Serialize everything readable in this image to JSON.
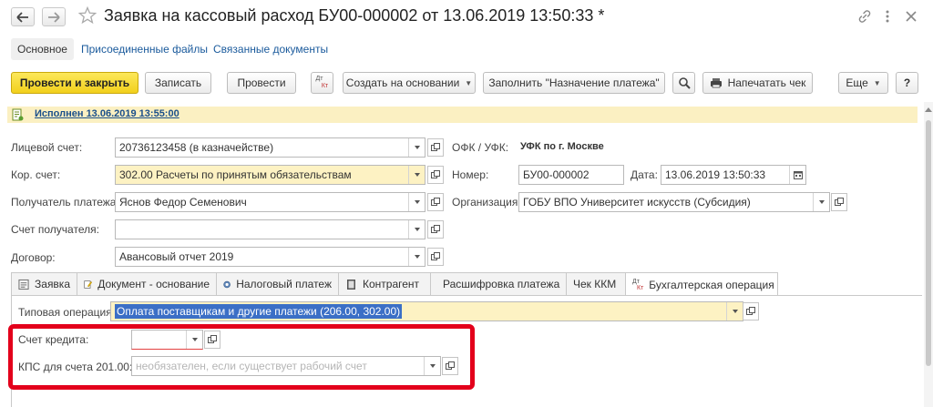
{
  "window": {
    "title": "Заявка на кассовый расход БУ00-000002 от 13.06.2019 13:50:33 *",
    "icons": [
      "back-arrow-icon",
      "forward-arrow-icon",
      "star-icon",
      "link-icon",
      "more-vertical-icon",
      "close-icon"
    ]
  },
  "sections": [
    {
      "label": "Основное"
    },
    {
      "label": "Присоединенные файлы"
    },
    {
      "label": "Связанные документы"
    }
  ],
  "toolbar": {
    "post_close": "Провести и закрыть",
    "save": "Записать",
    "post": "Провести",
    "dt_kt_top": "Дт",
    "dt_kt_bottom": "Кт",
    "create_based": "Создать на основании",
    "fill_purpose": "Заполнить \"Назначение платежа\"",
    "print_receipt": "Напечатать чек",
    "more": "Еще",
    "help": "?"
  },
  "status": {
    "text": "Исполнен 13.06.2019 13:55:00"
  },
  "form": {
    "account_label": "Лицевой счет:",
    "account_value": "20736123458 (в казначействе)",
    "corr_label": "Кор. счет:",
    "corr_value": "302.00 Расчеты по принятым обязательствам",
    "payee_label": "Получатель платежа:",
    "payee_value": "Яснов Федор Семенович",
    "payee_account_label": "Счет получателя:",
    "payee_account_value": "",
    "contract_label": "Договор:",
    "contract_value": "Авансовый отчет 2019",
    "ofk_label": "ОФК / УФК:",
    "ofk_value": "УФК по г. Москве",
    "number_label": "Номер:",
    "number_value": "БУ00-000002",
    "date_label": "Дата:",
    "date_value": "13.06.2019 13:50:33",
    "org_label": "Организация:",
    "org_value": "ГОБУ ВПО Университет искусств (Субсидия)"
  },
  "tabs": [
    {
      "label": "Заявка",
      "icon": "form-icon"
    },
    {
      "label": "Документ - основание",
      "icon": "document-edit-icon"
    },
    {
      "label": "Налоговый платеж",
      "icon": "tax-icon"
    },
    {
      "label": "Контрагент",
      "icon": "book-icon"
    },
    {
      "label": "Расшифровка платежа",
      "icon": "table-icon"
    },
    {
      "label": "Чек ККМ",
      "icon": ""
    },
    {
      "label": "Бухгалтерская операция",
      "icon": "dt-kt-icon"
    }
  ],
  "operation": {
    "typical_label": "Типовая операция:",
    "typical_value": "Оплата поставщикам и другие платежи (206.00, 302.00)",
    "credit_label": "Счет кредита:",
    "credit_value": "",
    "kps_label": "КПС для счета 201.00:",
    "kps_placeholder": "необязателен, если существует рабочий счет"
  },
  "colors": {
    "primary_button": "#f2d01c",
    "highlight_field": "#fdf2c3",
    "status_bar": "#fbf0c2",
    "link": "#1a5a9c",
    "callout_red": "#e3001b",
    "selection": "#3b6fc6"
  }
}
